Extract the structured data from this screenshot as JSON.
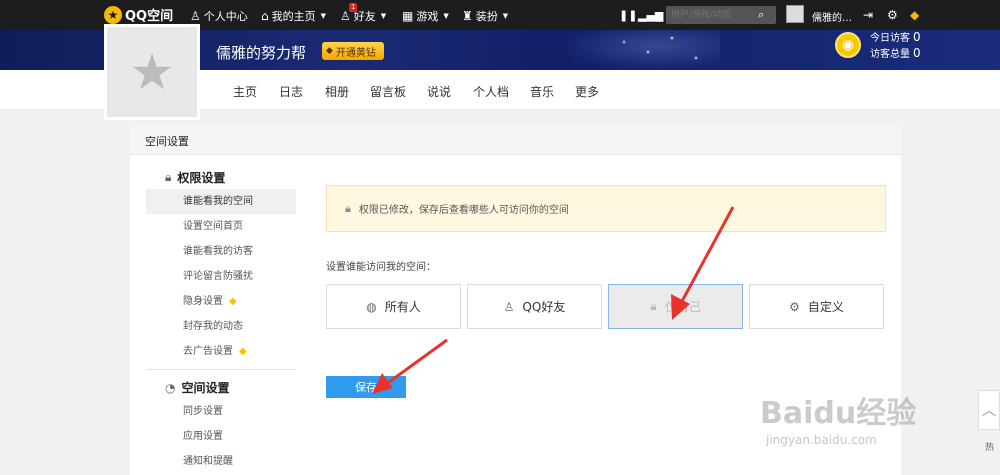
{
  "topbar": {
    "logo": "QQ空间",
    "personal_center": "个人中心",
    "my_home": "我的主页",
    "friends": "好友",
    "friends_badge": "1",
    "games": "游戏",
    "decorate": "装扮",
    "search_placeholder": "用户/游戏/动态",
    "username": "儒雅的…"
  },
  "banner": {
    "site_name": "儒雅的努力帮",
    "vip_button": "开通黄钻",
    "today_visitors_label": "今日访客",
    "today_visitors": "0",
    "total_visitors_label": "访客总量",
    "total_visitors": "0"
  },
  "nav": {
    "tabs": [
      "主页",
      "日志",
      "相册",
      "留言板",
      "说说",
      "个人档",
      "音乐",
      "更多"
    ]
  },
  "panel": {
    "title": "空间设置",
    "groups": [
      {
        "title": "权限设置",
        "items": [
          "谁能看我的空间",
          "设置空间首页",
          "谁能看我的访客",
          "评论留言防骚扰",
          "隐身设置",
          "封存我的动态",
          "去广告设置"
        ]
      },
      {
        "title": "空间设置",
        "items": [
          "同步设置",
          "应用设置",
          "通知和提醒"
        ]
      }
    ],
    "notice": "权限已修改，保存后查看哪些人可访问你的空间",
    "prompt": "设置谁能访问我的空间：",
    "options": [
      "所有人",
      "QQ好友",
      "仅自己",
      "自定义"
    ],
    "selected_option": "仅自己",
    "save": "保存"
  },
  "watermark": {
    "brand": "Baidu经验",
    "url": "jingyan.baidu.com"
  },
  "float": {
    "hot": "热"
  },
  "colors": {
    "topbar": "#1d1d1f",
    "save_button": "#2f9bec",
    "vip_gold": "#f5a700",
    "arrow": "#e8332d"
  }
}
